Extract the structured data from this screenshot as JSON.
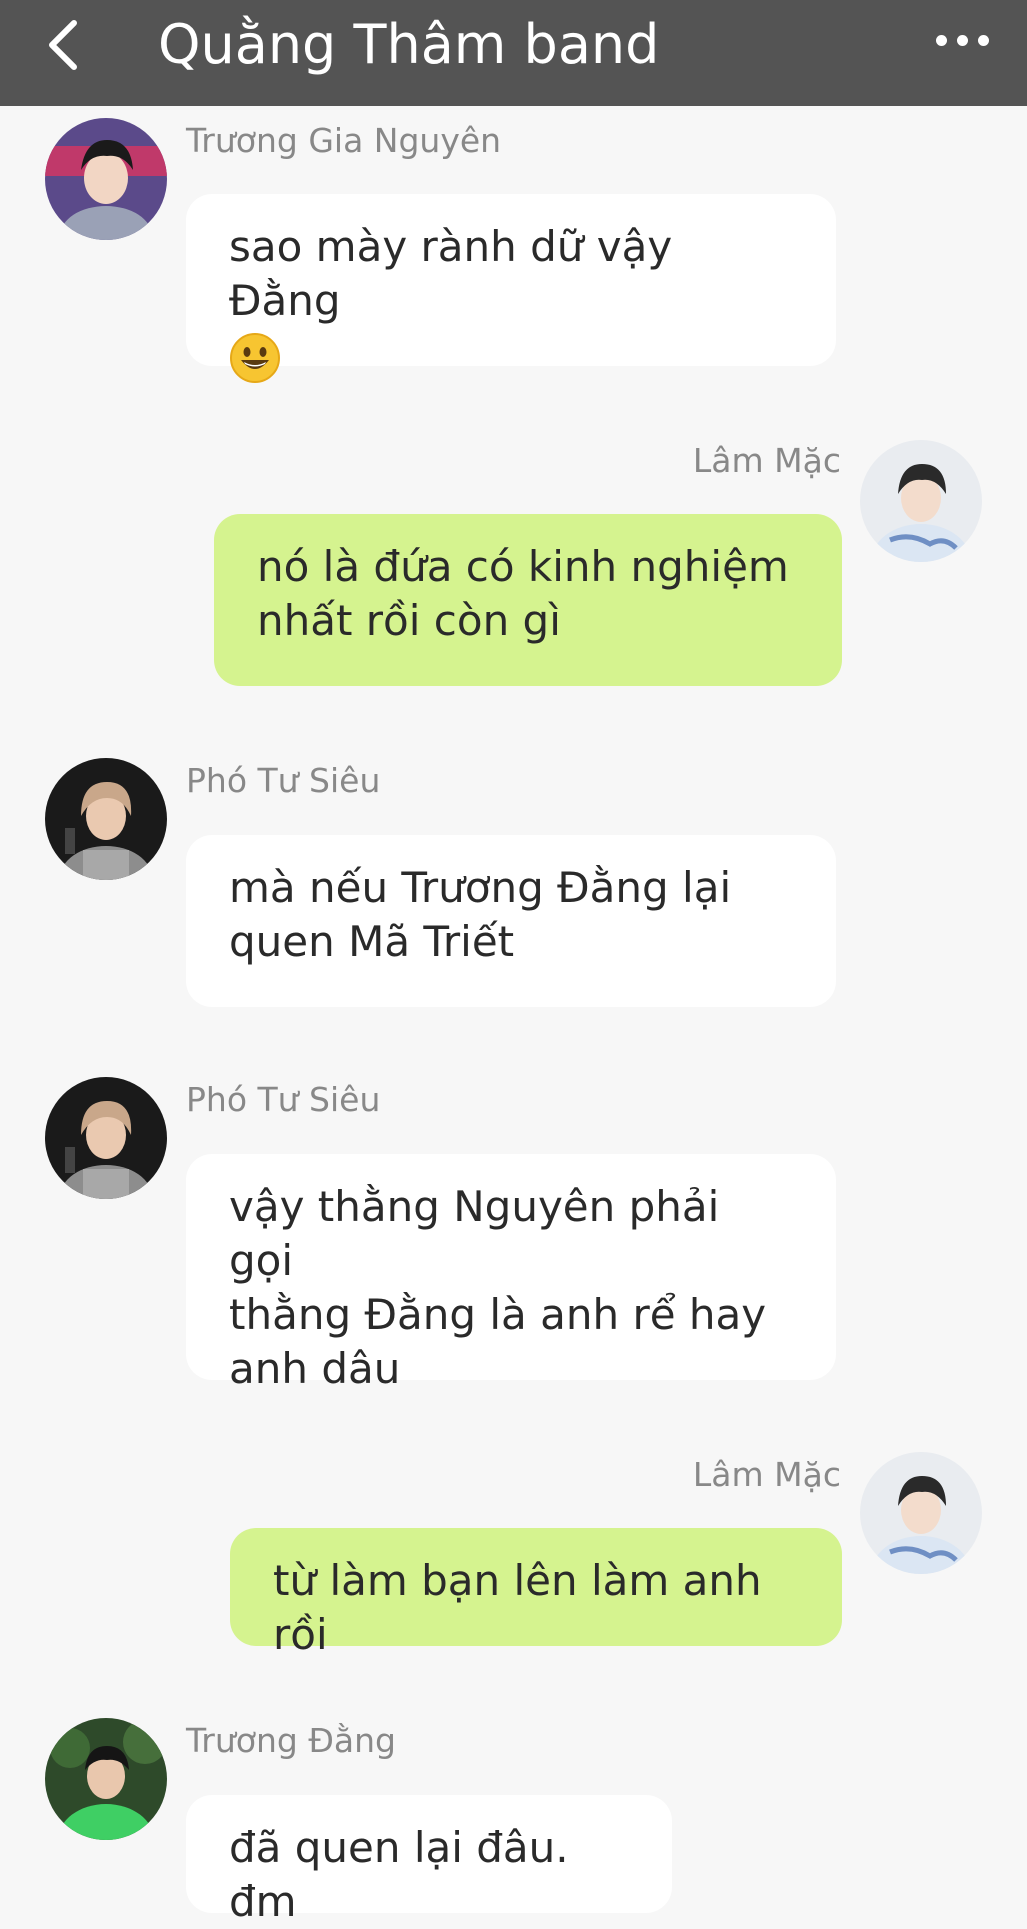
{
  "header": {
    "title": "Quằng Thâm band",
    "back_icon": "chevron-left-icon",
    "menu_icon": "more-horizontal-icon"
  },
  "messages": [
    {
      "sender": "Trương Gia Nguyên",
      "side": "left",
      "lines": [
        "sao mày rành dữ vậy Đằng",
        "😀"
      ]
    },
    {
      "sender": "Lâm Mặc",
      "side": "right",
      "lines": [
        "nó là đứa có kinh nghiệm",
        "nhất rồi còn gì"
      ]
    },
    {
      "sender": "Phó Tư Siêu",
      "side": "left",
      "lines": [
        "mà nếu Trương Đằng lại",
        "quen Mã Triết"
      ]
    },
    {
      "sender": "Phó Tư Siêu",
      "side": "left",
      "lines": [
        "vậy thằng Nguyên phải gọi",
        "thằng Đằng là anh rể hay",
        "anh dâu"
      ]
    },
    {
      "sender": "Lâm Mặc",
      "side": "right",
      "lines": [
        "từ làm bạn lên làm anh rồi"
      ]
    },
    {
      "sender": "Trương Đằng",
      "side": "left",
      "lines": [
        "đã quen lại đâu. đm"
      ]
    }
  ],
  "colors": {
    "header_bg": "#545454",
    "chat_bg": "#f7f7f7",
    "incoming_bubble": "#ffffff",
    "outgoing_bubble": "#d5f38f",
    "sender_name": "#888888"
  }
}
